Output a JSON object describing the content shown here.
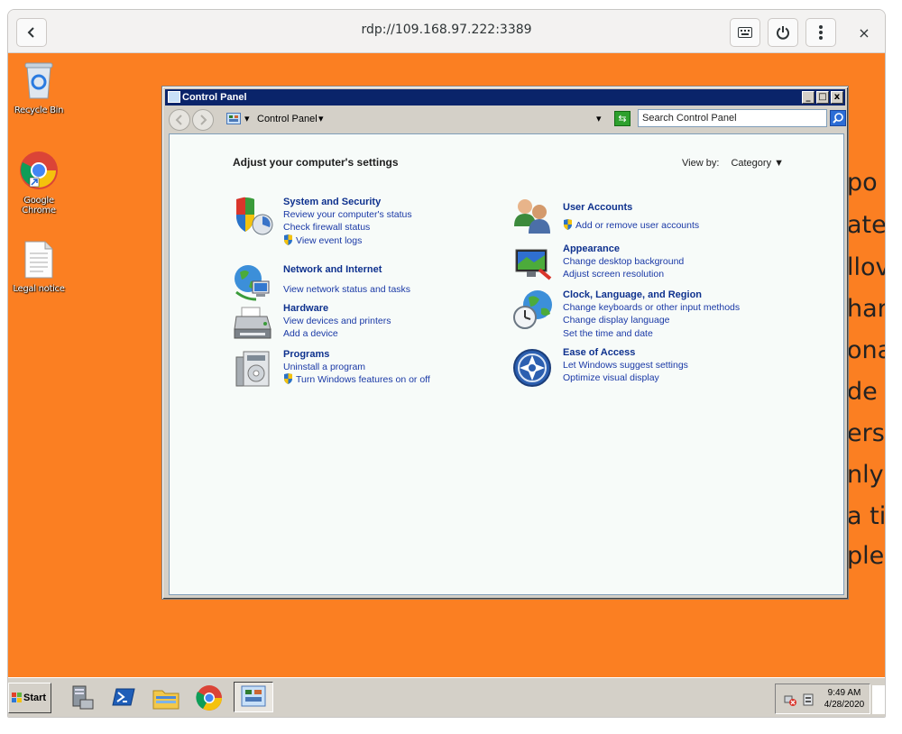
{
  "client": {
    "title": "rdp://109.168.97.222:3389",
    "icons": {
      "back": "chevron-left-icon",
      "keyboard": "keyboard-icon",
      "power": "power-icon",
      "menu": "vertical-dots-icon",
      "close": "close-icon"
    },
    "close_glyph": "×"
  },
  "desktop": {
    "background_color": "#fb7f22",
    "icons": [
      {
        "label": "Recycle Bin",
        "icon": "recycle-bin-icon"
      },
      {
        "label": "Google Chrome",
        "icon": "chrome-icon"
      },
      {
        "label": "Legal notice",
        "icon": "document-icon"
      }
    ],
    "background_text": [
      "po",
      "ate",
      "llov",
      "har",
      "ona",
      "de",
      "ers.",
      "nly",
      "a ti",
      "ple"
    ]
  },
  "window": {
    "title": "Control Panel",
    "buttons": {
      "minimize": "_",
      "maximize": "□",
      "close": "x"
    },
    "address": "Control Panel",
    "search_placeholder": "Search Control Panel",
    "heading": "Adjust your computer's settings",
    "view_by_label": "View by:",
    "view_by_value": "Category",
    "categories": [
      {
        "title": "System and Security",
        "icon": "system-security-icon",
        "links": [
          {
            "text": "Review your computer's status",
            "shield": false
          },
          {
            "text": "Check firewall status",
            "shield": false
          },
          {
            "text": "View event logs",
            "shield": true
          }
        ]
      },
      {
        "title": "Network and Internet",
        "icon": "network-internet-icon",
        "links": [
          {
            "text": "View network status and tasks",
            "shield": false
          }
        ]
      },
      {
        "title": "Hardware",
        "icon": "hardware-printer-icon",
        "links": [
          {
            "text": "View devices and printers",
            "shield": false
          },
          {
            "text": "Add a device",
            "shield": false
          }
        ]
      },
      {
        "title": "Programs",
        "icon": "programs-icon",
        "links": [
          {
            "text": "Uninstall a program",
            "shield": false
          },
          {
            "text": "Turn Windows features on or off",
            "shield": true
          }
        ]
      },
      {
        "title": "User Accounts",
        "icon": "user-accounts-icon",
        "links": [
          {
            "text": "Add or remove user accounts",
            "shield": true
          }
        ]
      },
      {
        "title": "Appearance",
        "icon": "appearance-icon",
        "links": [
          {
            "text": "Change desktop background",
            "shield": false
          },
          {
            "text": "Adjust screen resolution",
            "shield": false
          }
        ]
      },
      {
        "title": "Clock, Language, and Region",
        "icon": "clock-globe-icon",
        "links": [
          {
            "text": "Change keyboards or other input methods",
            "shield": false
          },
          {
            "text": "Change display language",
            "shield": false
          },
          {
            "text": "Set the time and date",
            "shield": false
          }
        ]
      },
      {
        "title": "Ease of Access",
        "icon": "ease-of-access-icon",
        "links": [
          {
            "text": "Let Windows suggest settings",
            "shield": false
          },
          {
            "text": "Optimize visual display",
            "shield": false
          }
        ]
      }
    ]
  },
  "taskbar": {
    "start_label": "Start",
    "apps": [
      "server-manager-icon",
      "powershell-icon",
      "file-explorer-icon",
      "chrome-icon",
      "control-panel-icon"
    ],
    "tray_icons": [
      "network-disconnected-icon",
      "action-center-icon"
    ],
    "time": "9:49 AM",
    "date": "4/28/2020"
  }
}
